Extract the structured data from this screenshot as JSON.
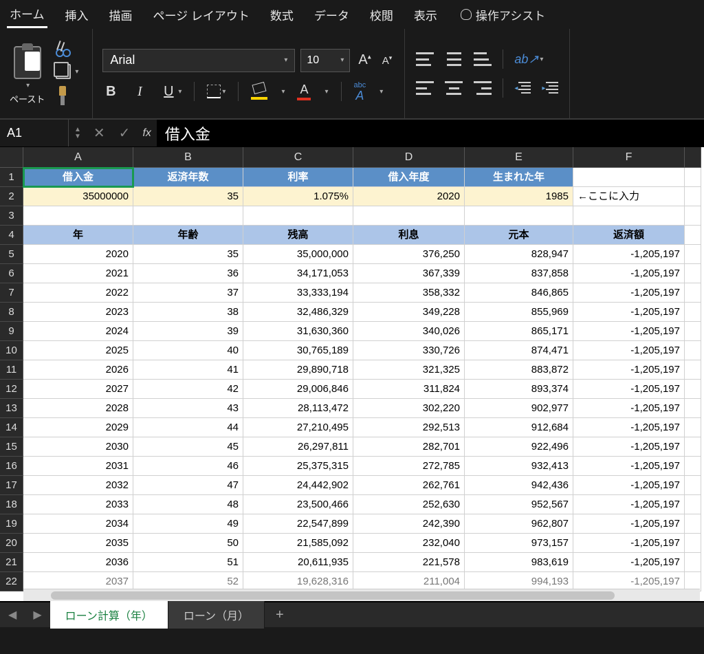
{
  "ribbon_tabs": [
    "ホーム",
    "挿入",
    "描画",
    "ページ レイアウト",
    "数式",
    "データ",
    "校閲",
    "表示"
  ],
  "assist_label": "操作アシスト",
  "paste_label": "ペースト",
  "font": {
    "name": "Arial",
    "size": "10"
  },
  "name_box": "A1",
  "formula_value": "借入金",
  "columns": [
    "A",
    "B",
    "C",
    "D",
    "E",
    "F"
  ],
  "rows": [
    "1",
    "2",
    "3",
    "4",
    "5",
    "6",
    "7",
    "8",
    "9",
    "10",
    "11",
    "12",
    "13",
    "14",
    "15",
    "16",
    "17",
    "18",
    "19",
    "20",
    "21",
    "22"
  ],
  "headers1": {
    "A": "借入金",
    "B": "返済年数",
    "C": "利率",
    "D": "借入年度",
    "E": "生まれた年"
  },
  "inputs": {
    "A": "35000000",
    "B": "35",
    "C": "1.075%",
    "D": "2020",
    "E": "1985",
    "F": "←ここに入力"
  },
  "headers2": {
    "A": "年",
    "B": "年齢",
    "C": "残高",
    "D": "利息",
    "E": "元本",
    "F": "返済額"
  },
  "data_rows": [
    {
      "A": "2020",
      "B": "35",
      "C": "35,000,000",
      "D": "376,250",
      "E": "828,947",
      "F": "-1,205,197"
    },
    {
      "A": "2021",
      "B": "36",
      "C": "34,171,053",
      "D": "367,339",
      "E": "837,858",
      "F": "-1,205,197"
    },
    {
      "A": "2022",
      "B": "37",
      "C": "33,333,194",
      "D": "358,332",
      "E": "846,865",
      "F": "-1,205,197"
    },
    {
      "A": "2023",
      "B": "38",
      "C": "32,486,329",
      "D": "349,228",
      "E": "855,969",
      "F": "-1,205,197"
    },
    {
      "A": "2024",
      "B": "39",
      "C": "31,630,360",
      "D": "340,026",
      "E": "865,171",
      "F": "-1,205,197"
    },
    {
      "A": "2025",
      "B": "40",
      "C": "30,765,189",
      "D": "330,726",
      "E": "874,471",
      "F": "-1,205,197"
    },
    {
      "A": "2026",
      "B": "41",
      "C": "29,890,718",
      "D": "321,325",
      "E": "883,872",
      "F": "-1,205,197"
    },
    {
      "A": "2027",
      "B": "42",
      "C": "29,006,846",
      "D": "311,824",
      "E": "893,374",
      "F": "-1,205,197"
    },
    {
      "A": "2028",
      "B": "43",
      "C": "28,113,472",
      "D": "302,220",
      "E": "902,977",
      "F": "-1,205,197"
    },
    {
      "A": "2029",
      "B": "44",
      "C": "27,210,495",
      "D": "292,513",
      "E": "912,684",
      "F": "-1,205,197"
    },
    {
      "A": "2030",
      "B": "45",
      "C": "26,297,811",
      "D": "282,701",
      "E": "922,496",
      "F": "-1,205,197"
    },
    {
      "A": "2031",
      "B": "46",
      "C": "25,375,315",
      "D": "272,785",
      "E": "932,413",
      "F": "-1,205,197"
    },
    {
      "A": "2032",
      "B": "47",
      "C": "24,442,902",
      "D": "262,761",
      "E": "942,436",
      "F": "-1,205,197"
    },
    {
      "A": "2033",
      "B": "48",
      "C": "23,500,466",
      "D": "252,630",
      "E": "952,567",
      "F": "-1,205,197"
    },
    {
      "A": "2034",
      "B": "49",
      "C": "22,547,899",
      "D": "242,390",
      "E": "962,807",
      "F": "-1,205,197"
    },
    {
      "A": "2035",
      "B": "50",
      "C": "21,585,092",
      "D": "232,040",
      "E": "973,157",
      "F": "-1,205,197"
    },
    {
      "A": "2036",
      "B": "51",
      "C": "20,611,935",
      "D": "221,578",
      "E": "983,619",
      "F": "-1,205,197"
    },
    {
      "A": "2037",
      "B": "52",
      "C": "19,628,316",
      "D": "211,004",
      "E": "994,193",
      "F": "-1,205,197"
    }
  ],
  "sheet_tabs": [
    "ローン計算（年）",
    "ローン（月）"
  ],
  "active_sheet": 0
}
